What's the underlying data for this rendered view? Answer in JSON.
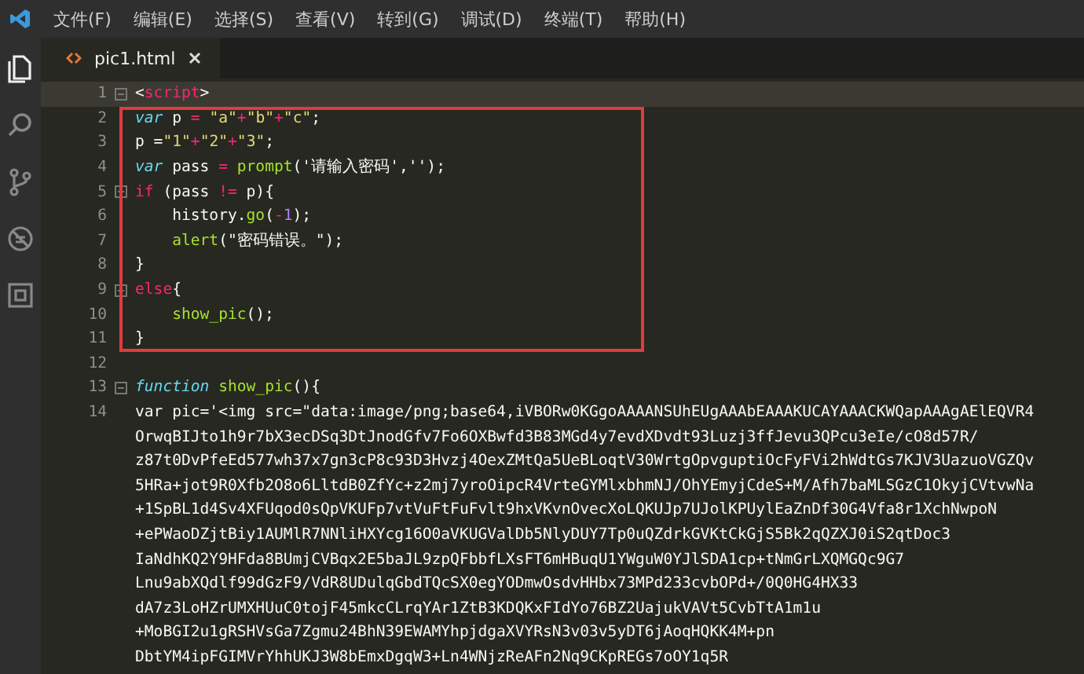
{
  "menu_bar": {
    "items": [
      "文件(F)",
      "编辑(E)",
      "选择(S)",
      "查看(V)",
      "转到(G)",
      "调试(D)",
      "终端(T)",
      "帮助(H)"
    ]
  },
  "activity_bar": {
    "items": [
      {
        "kind": "files",
        "selected": true
      },
      {
        "kind": "search",
        "selected": false
      },
      {
        "kind": "source-control",
        "selected": false
      },
      {
        "kind": "debug",
        "selected": false
      },
      {
        "kind": "extensions",
        "selected": false
      }
    ]
  },
  "tabs": [
    {
      "label": "pic1.html",
      "selected": true
    }
  ],
  "editor": {
    "rows": [
      {
        "number": "1",
        "foldable": true,
        "current": true,
        "in_box": false,
        "indent": false,
        "tokens": [
          {
            "text": "<",
            "kind": "plain"
          },
          {
            "text": "script",
            "kind": "tag"
          },
          {
            "text": ">",
            "kind": "plain"
          }
        ]
      },
      {
        "number": "2",
        "foldable": false,
        "current": false,
        "in_box": true,
        "indent": false,
        "tokens": [
          {
            "text": "var",
            "kind": "keyword"
          },
          {
            "text": " p ",
            "kind": "plain"
          },
          {
            "text": "= ",
            "kind": "operator"
          },
          {
            "text": "\"a\"",
            "kind": "string"
          },
          {
            "text": "+",
            "kind": "operator"
          },
          {
            "text": "\"b\"",
            "kind": "string"
          },
          {
            "text": "+",
            "kind": "operator"
          },
          {
            "text": "\"c\"",
            "kind": "string"
          },
          {
            "text": ";",
            "kind": "plain"
          }
        ]
      },
      {
        "number": "3",
        "foldable": false,
        "current": false,
        "in_box": true,
        "indent": false,
        "tokens": [
          {
            "text": "p =",
            "kind": "plain"
          },
          {
            "text": "\"1\"",
            "kind": "string"
          },
          {
            "text": "+",
            "kind": "operator"
          },
          {
            "text": "\"2\"",
            "kind": "string"
          },
          {
            "text": "+",
            "kind": "operator"
          },
          {
            "text": "\"3\"",
            "kind": "string"
          },
          {
            "text": ";",
            "kind": "plain"
          }
        ]
      },
      {
        "number": "4",
        "foldable": false,
        "current": false,
        "in_box": true,
        "indent": false,
        "tokens": [
          {
            "text": "var",
            "kind": "keyword"
          },
          {
            "text": " pass ",
            "kind": "plain"
          },
          {
            "text": "= ",
            "kind": "operator"
          },
          {
            "text": "prompt",
            "kind": "function"
          },
          {
            "text": "('请输入密码','');",
            "kind": "plain"
          }
        ]
      },
      {
        "number": "5",
        "foldable": true,
        "current": false,
        "in_box": true,
        "indent": false,
        "tokens": [
          {
            "text": "if",
            "kind": "operator"
          },
          {
            "text": " (pass ",
            "kind": "plain"
          },
          {
            "text": "!=",
            "kind": "operator"
          },
          {
            "text": " p){",
            "kind": "plain"
          }
        ]
      },
      {
        "number": "6",
        "foldable": false,
        "current": false,
        "in_box": true,
        "indent": true,
        "tokens": [
          {
            "text": "history.",
            "kind": "plain"
          },
          {
            "text": "go",
            "kind": "function"
          },
          {
            "text": "(",
            "kind": "plain"
          },
          {
            "text": "-",
            "kind": "operator"
          },
          {
            "text": "1",
            "kind": "number"
          },
          {
            "text": ");",
            "kind": "plain"
          }
        ]
      },
      {
        "number": "7",
        "foldable": false,
        "current": false,
        "in_box": true,
        "indent": true,
        "tokens": [
          {
            "text": "alert",
            "kind": "function"
          },
          {
            "text": "(\"密码错误。\");",
            "kind": "plain"
          }
        ]
      },
      {
        "number": "8",
        "foldable": false,
        "current": false,
        "in_box": true,
        "indent": false,
        "tokens": [
          {
            "text": "}",
            "kind": "plain"
          }
        ]
      },
      {
        "number": "9",
        "foldable": true,
        "current": false,
        "in_box": true,
        "indent": false,
        "tokens": [
          {
            "text": "else",
            "kind": "operator"
          },
          {
            "text": "{",
            "kind": "plain"
          }
        ]
      },
      {
        "number": "10",
        "foldable": false,
        "current": false,
        "in_box": true,
        "indent": true,
        "tokens": [
          {
            "text": "show_pic",
            "kind": "function"
          },
          {
            "text": "();",
            "kind": "plain"
          }
        ]
      },
      {
        "number": "11",
        "foldable": false,
        "current": false,
        "in_box": true,
        "indent": false,
        "tokens": [
          {
            "text": "}",
            "kind": "plain"
          }
        ]
      },
      {
        "number": "12",
        "foldable": false,
        "current": false,
        "in_box": false,
        "tokens": []
      },
      {
        "number": "13",
        "foldable": true,
        "current": false,
        "in_box": false,
        "indent": false,
        "tokens": [
          {
            "text": "function ",
            "kind": "keyword"
          },
          {
            "text": "show_pic",
            "kind": "function"
          },
          {
            "text": "(){",
            "kind": "plain"
          }
        ]
      },
      {
        "number": "14",
        "foldable": false,
        "current": false,
        "in_box": false,
        "indent": false,
        "tokens": [
          {
            "text": "var pic='<img src=\"data:image/png;base64,iVBORw0KGgoAAAANSUhEUgAAAbEAAAKUCAYAAACKWQapAAAgAElEQVR4",
            "kind": "plain"
          }
        ]
      },
      {
        "foldable": false,
        "current": false,
        "in_box": false,
        "indent": false,
        "tokens": [
          {
            "text": "OrwqBIJto1h9r7bX3ecDSq3DtJnodGfv7Fo6OXBwfd3B83MGd4y7evdXDvdt93Luzj3ffJevu3QPcu3eIe/cO8d57R/",
            "kind": "plain"
          }
        ]
      },
      {
        "foldable": false,
        "current": false,
        "in_box": false,
        "indent": false,
        "tokens": [
          {
            "text": "z87t0DvPfeEd577wh37x7gn3cP8c93D3Hvzj4OexZMtQa5UeBLoqtV30WrtgOpvguptiOcFyFVi2hWdtGs7KJV3UazuoVGZQv",
            "kind": "plain"
          }
        ]
      },
      {
        "foldable": false,
        "current": false,
        "in_box": false,
        "indent": false,
        "tokens": [
          {
            "text": "5HRa+jot9R0Xfb2O8o6LltdB0ZfYc+z2mj7yroOipcR4VrteGYMlxbhmNJ/OhYEmyjCdeS+M/Afh7baMLSGzC1OkyjCVtvwNa",
            "kind": "plain"
          }
        ]
      },
      {
        "foldable": false,
        "current": false,
        "in_box": false,
        "indent": false,
        "tokens": [
          {
            "text": "+1SpBL1d4Sv4XFUqod0sQpVKUFp7vtVuFtFuFvlt9hxVKvnOvecXoLQKUJp7UJolKPUylEaZnDf30G4Vfa8r1XchNwpoN",
            "kind": "plain"
          }
        ]
      },
      {
        "foldable": false,
        "current": false,
        "in_box": false,
        "indent": false,
        "tokens": [
          {
            "text": "+ePWaoDZjtBiy1AUMlR7NNliHXYcg16O0aVKUGValDb5NlyDUY7Tp0uQZdrkGVKtCkGjS5Bk2qQZXJ0iS2qtDoc3",
            "kind": "plain"
          }
        ]
      },
      {
        "foldable": false,
        "current": false,
        "in_box": false,
        "indent": false,
        "tokens": [
          {
            "text": "IaNdhKQ2Y9HFda8BUmjCVBqx2E5baJL9zpQFbbfLXsFT6mHBuqU1YWguW0YJlSDA1cp+tNmGrLXQMGQc9G7",
            "kind": "plain"
          }
        ]
      },
      {
        "foldable": false,
        "current": false,
        "in_box": false,
        "indent": false,
        "tokens": [
          {
            "text": "Lnu9abXQdlf99dGzF9/VdR8UDulqGbdTQcSX0egYODmwOsdvHHbx73MPd233cvbOPd+/0Q0HG4HX33",
            "kind": "plain"
          }
        ]
      },
      {
        "foldable": false,
        "current": false,
        "in_box": false,
        "indent": false,
        "tokens": [
          {
            "text": "dA7z3LoHZrUMXHUuC0tojF45mkcCLrqYAr1ZtB3KDQKxFIdYo76BZ2UajukVAVt5CvbTtA1m1u",
            "kind": "plain"
          }
        ]
      },
      {
        "foldable": false,
        "current": false,
        "in_box": false,
        "indent": false,
        "tokens": [
          {
            "text": "+MoBGI2u1gRSHVsGa7Zgmu24BhN39EWAMYhpjdgaXVYRsN3v03v5yDT6jAoqHQKK4M+pn",
            "kind": "plain"
          }
        ]
      },
      {
        "foldable": false,
        "current": false,
        "in_box": false,
        "indent": false,
        "tokens": [
          {
            "text": "DbtYM4ipFGIMVrYhhUKJ3W8bEmxDgqW3+Ln4WNjzReAFn2Nq9CKpREGs7oOY1q5R",
            "kind": "plain"
          }
        ]
      }
    ]
  }
}
